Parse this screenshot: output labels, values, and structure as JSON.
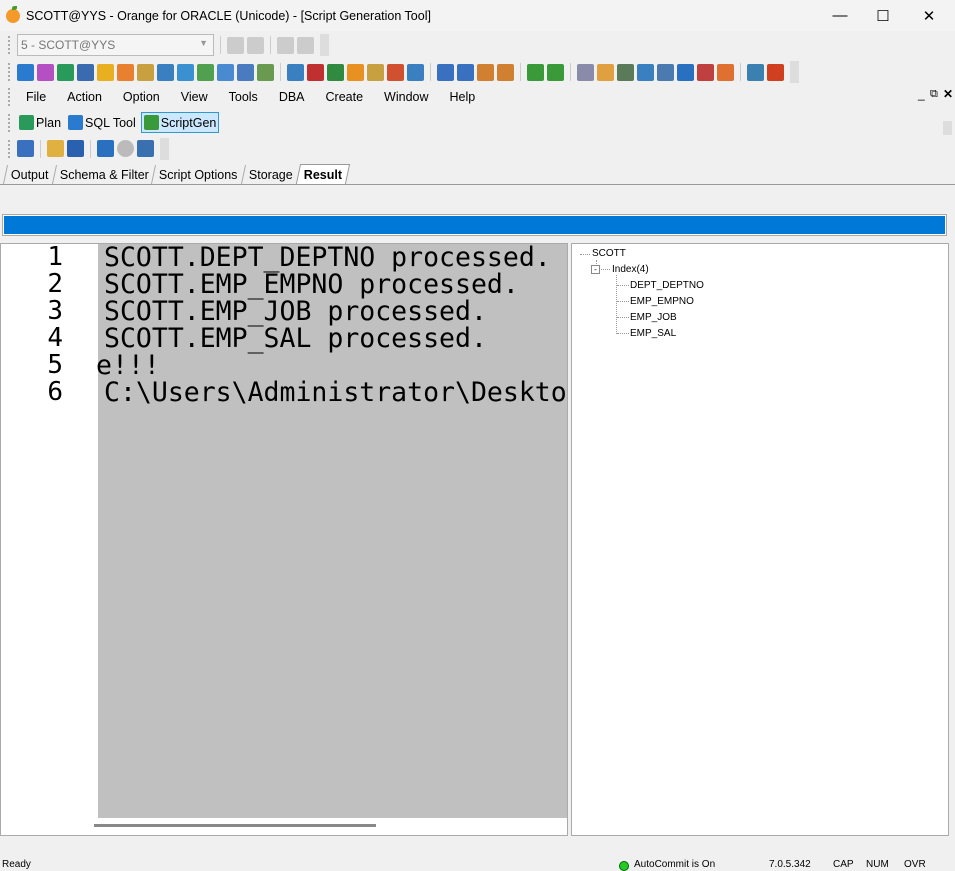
{
  "window": {
    "title": "SCOTT@YYS - Orange for ORACLE (Unicode) - [Script Generation Tool]"
  },
  "connection_combo": {
    "value": "5 - SCOTT@YYS"
  },
  "menu": [
    "File",
    "Action",
    "Option",
    "View",
    "Tools",
    "DBA",
    "Create",
    "Window",
    "Help"
  ],
  "tool_tabs": [
    {
      "label": "Plan",
      "icon": "plan-icon"
    },
    {
      "label": "SQL Tool",
      "icon": "sql-icon"
    },
    {
      "label": "ScriptGen",
      "icon": "scriptgen-icon",
      "active": true
    }
  ],
  "tabs": [
    {
      "label": "Output"
    },
    {
      "label": "Schema & Filter"
    },
    {
      "label": "Script Options"
    },
    {
      "label": "Storage"
    },
    {
      "label": "Result",
      "active": true
    }
  ],
  "progress": {
    "percent": 100,
    "color": "#0078d7"
  },
  "editor": {
    "lines": [
      {
        "num": "1",
        "text": "SCOTT.DEPT_DEPTNO processed."
      },
      {
        "num": "2",
        "text": "SCOTT.EMP_EMPNO processed."
      },
      {
        "num": "3",
        "text": "SCOTT.EMP_JOB processed."
      },
      {
        "num": "4",
        "text": "SCOTT.EMP_SAL processed."
      },
      {
        "num": "5",
        "text": "e!!!"
      },
      {
        "num": "6",
        "text": "C:\\Users\\Administrator\\Deskto"
      }
    ]
  },
  "tree": {
    "root": "SCOTT",
    "group": "Index(4)",
    "items": [
      "DEPT_DEPTNO",
      "EMP_EMPNO",
      "EMP_JOB",
      "EMP_SAL"
    ]
  },
  "status": {
    "ready": "Ready",
    "autocommit": "AutoCommit is On",
    "version": "7.0.5.342",
    "cap": "CAP",
    "num": "NUM",
    "ovr": "OVR",
    "autocommit_color": "#22cc22"
  }
}
